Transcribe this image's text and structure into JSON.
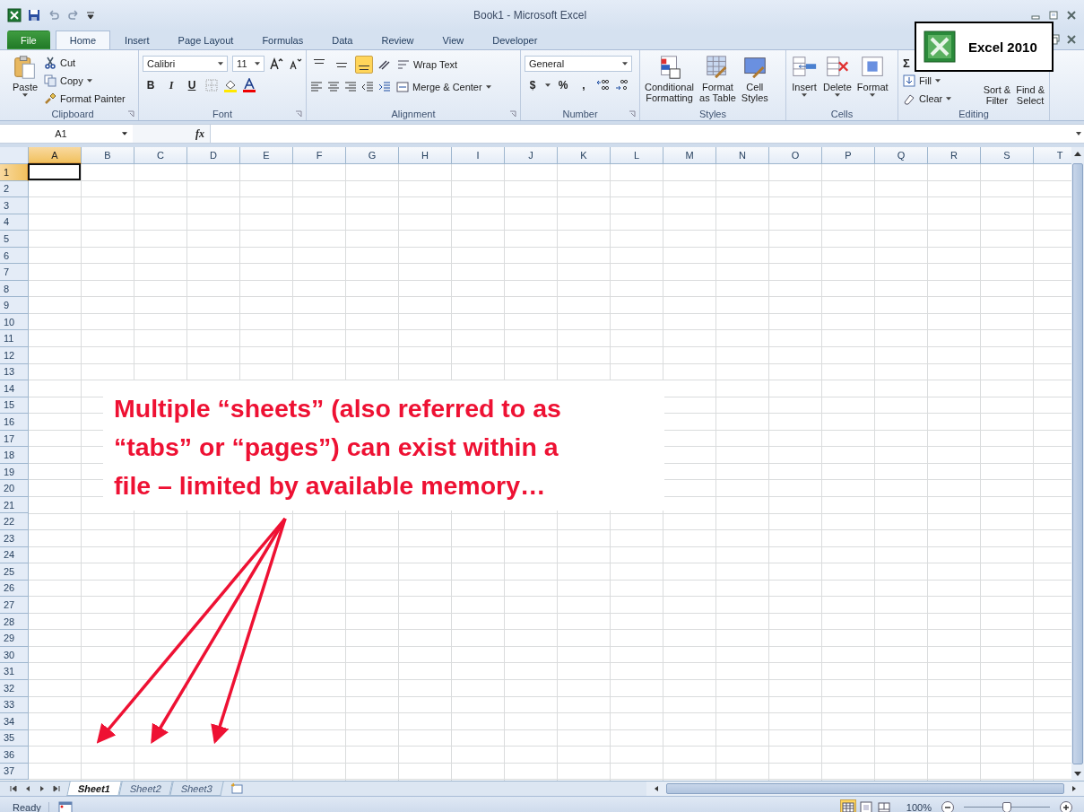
{
  "window": {
    "title": "Book1  -  Microsoft Excel"
  },
  "ribbon_tabs": [
    {
      "label": "File",
      "kind": "file",
      "selected": false
    },
    {
      "label": "Home",
      "kind": "tab",
      "selected": true
    },
    {
      "label": "Insert",
      "kind": "tab",
      "selected": false
    },
    {
      "label": "Page Layout",
      "kind": "tab",
      "selected": false
    },
    {
      "label": "Formulas",
      "kind": "tab",
      "selected": false
    },
    {
      "label": "Data",
      "kind": "tab",
      "selected": false
    },
    {
      "label": "Review",
      "kind": "tab",
      "selected": false
    },
    {
      "label": "View",
      "kind": "tab",
      "selected": false
    },
    {
      "label": "Developer",
      "kind": "tab",
      "selected": false
    }
  ],
  "clipboard": {
    "label": "Clipboard",
    "paste": "Paste",
    "cut": "Cut",
    "copy": "Copy",
    "format_painter": "Format Painter"
  },
  "font": {
    "label": "Font",
    "family": "Calibri",
    "size": "11",
    "bold": "B",
    "italic": "I",
    "underline": "U"
  },
  "alignment": {
    "label": "Alignment",
    "vertical_align": [
      {
        "kind": "top",
        "selected": false
      },
      {
        "kind": "middle",
        "selected": false
      },
      {
        "kind": "bottom",
        "selected": true
      }
    ],
    "wrap_text": "Wrap Text",
    "merge_center": "Merge & Center"
  },
  "number": {
    "label": "Number",
    "format": "General",
    "currency": "$",
    "percent": "%",
    "comma": ","
  },
  "styles": {
    "label": "Styles",
    "buttons": [
      {
        "kind": "conditional",
        "lines": [
          "Conditional",
          "Formatting"
        ]
      },
      {
        "kind": "table",
        "lines": [
          "Format",
          "as Table"
        ]
      },
      {
        "kind": "cell",
        "lines": [
          "Cell",
          "Styles"
        ]
      }
    ]
  },
  "cells": {
    "label": "Cells",
    "buttons": [
      {
        "kind": "insert",
        "label": "Insert"
      },
      {
        "kind": "delete",
        "label": "Delete"
      },
      {
        "kind": "format",
        "label": "Format"
      }
    ]
  },
  "editing": {
    "label": "Editing",
    "sum": "Σ",
    "fill": "Fill",
    "clear": "Clear",
    "sort_filter": [
      "Sort &",
      "Filter"
    ],
    "find_select": [
      "Find &",
      "Select"
    ]
  },
  "formula_bar": {
    "name_box": "A1",
    "fx": "fx"
  },
  "grid": {
    "columns": [
      {
        "label": "A",
        "selected": true
      },
      {
        "label": "B",
        "selected": false
      },
      {
        "label": "C",
        "selected": false
      },
      {
        "label": "D",
        "selected": false
      },
      {
        "label": "E",
        "selected": false
      },
      {
        "label": "F",
        "selected": false
      },
      {
        "label": "G",
        "selected": false
      },
      {
        "label": "H",
        "selected": false
      },
      {
        "label": "I",
        "selected": false
      },
      {
        "label": "J",
        "selected": false
      },
      {
        "label": "K",
        "selected": false
      },
      {
        "label": "L",
        "selected": false
      },
      {
        "label": "M",
        "selected": false
      },
      {
        "label": "N",
        "selected": false
      },
      {
        "label": "O",
        "selected": false
      },
      {
        "label": "P",
        "selected": false
      },
      {
        "label": "Q",
        "selected": false
      },
      {
        "label": "R",
        "selected": false
      },
      {
        "label": "S",
        "selected": false
      },
      {
        "label": "T",
        "selected": false
      }
    ],
    "rows": [
      {
        "label": "1",
        "selected": true
      },
      {
        "label": "2",
        "selected": false
      },
      {
        "label": "3",
        "selected": false
      },
      {
        "label": "4",
        "selected": false
      },
      {
        "label": "5",
        "selected": false
      },
      {
        "label": "6",
        "selected": false
      },
      {
        "label": "7",
        "selected": false
      },
      {
        "label": "8",
        "selected": false
      },
      {
        "label": "9",
        "selected": false
      },
      {
        "label": "10",
        "selected": false
      },
      {
        "label": "11",
        "selected": false
      },
      {
        "label": "12",
        "selected": false
      },
      {
        "label": "13",
        "selected": false
      },
      {
        "label": "14",
        "selected": false
      },
      {
        "label": "15",
        "selected": false
      },
      {
        "label": "16",
        "selected": false
      },
      {
        "label": "17",
        "selected": false
      },
      {
        "label": "18",
        "selected": false
      },
      {
        "label": "19",
        "selected": false
      },
      {
        "label": "20",
        "selected": false
      },
      {
        "label": "21",
        "selected": false
      },
      {
        "label": "22",
        "selected": false
      },
      {
        "label": "23",
        "selected": false
      },
      {
        "label": "24",
        "selected": false
      },
      {
        "label": "25",
        "selected": false
      },
      {
        "label": "26",
        "selected": false
      },
      {
        "label": "27",
        "selected": false
      },
      {
        "label": "28",
        "selected": false
      },
      {
        "label": "29",
        "selected": false
      },
      {
        "label": "30",
        "selected": false
      },
      {
        "label": "31",
        "selected": false
      },
      {
        "label": "32",
        "selected": false
      },
      {
        "label": "33",
        "selected": false
      },
      {
        "label": "34",
        "selected": false
      },
      {
        "label": "35",
        "selected": false
      },
      {
        "label": "36",
        "selected": false
      },
      {
        "label": "37",
        "selected": false
      }
    ]
  },
  "sheet_tabs": [
    {
      "label": "Sheet1",
      "selected": true
    },
    {
      "label": "Sheet2",
      "selected": false
    },
    {
      "label": "Sheet3",
      "selected": false
    }
  ],
  "status_bar": {
    "status": "Ready",
    "views": [
      {
        "kind": "normal",
        "selected": true
      },
      {
        "kind": "page_layout",
        "selected": false
      },
      {
        "kind": "page_break",
        "selected": false
      }
    ],
    "zoom": "100%",
    "zoom_slider": {
      "level": 0.5
    }
  },
  "callout": {
    "lines": [
      "Multiple “sheets” (also referred to as",
      "“tabs” or “pages”) can exist within a",
      "file – limited by available memory…"
    ]
  },
  "badge": {
    "label": "Excel 2010"
  }
}
